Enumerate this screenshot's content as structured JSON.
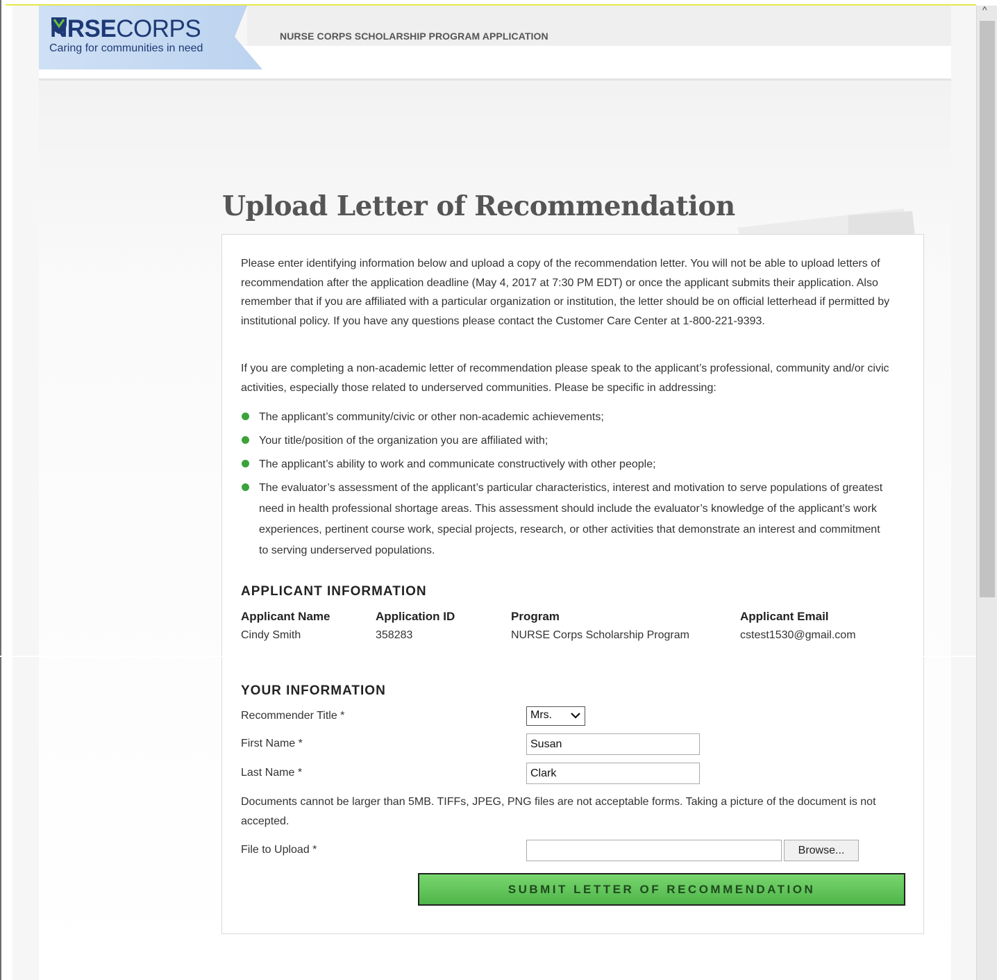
{
  "header": {
    "logo_main_bold_1": "N",
    "logo_main_bold_2": "RSE",
    "logo_main_thin": "CORPS",
    "logo_tagline": "Caring for communities in need",
    "title": "NURSE CORPS SCHOLARSHIP PROGRAM APPLICATION"
  },
  "page": {
    "heading": "Upload Letter of Recommendation",
    "intro_paragraphs": [
      "Please enter identifying information below and upload a copy of the recommendation letter. You will not be able to upload letters of recommendation after the application deadline (May 4, 2017 at 7:30 PM EDT) or once the applicant submits their application. Also remember that if you are affiliated with a particular organization or institution, the letter should be on official letterhead if permitted by institutional policy. If you have any questions please contact the Customer Care Center at 1-800-221-9393.",
      "If you are completing a non-academic letter of recommendation please speak to the applicant’s professional, community and/or civic activities, especially those related to underserved communities. Please be specific in addressing:"
    ],
    "bullets": [
      "The applicant’s community/civic or other non-academic achievements;",
      "Your title/position of the organization you are affiliated with;",
      "The applicant’s ability to work and communicate constructively with other people;",
      "The evaluator’s assessment of the applicant’s particular characteristics, interest and motivation to serve populations of greatest need in health professional shortage areas. This assessment should include the evaluator’s knowledge of the applicant’s work experiences, pertinent course work, special projects, research, or other activities that demonstrate an interest and commitment to serving underserved populations."
    ],
    "bullet_color": "#3aa33a"
  },
  "applicant": {
    "section_title": "APPLICANT INFORMATION",
    "columns": [
      {
        "header": "Applicant Name",
        "value": "Cindy Smith"
      },
      {
        "header": "Application ID",
        "value": "358283"
      },
      {
        "header": "Program",
        "value": "NURSE Corps Scholarship Program"
      },
      {
        "header": "Applicant Email",
        "value": "cstest1530@gmail.com"
      }
    ]
  },
  "your_info": {
    "section_title": "YOUR INFORMATION",
    "title_label": "Recommender Title *",
    "title_value": "Mrs.",
    "first_name_label": "First Name *",
    "first_name_value": "Susan",
    "last_name_label": "Last Name *",
    "last_name_value": "Clark",
    "documents_note": "Documents cannot be larger than 5MB. TIFFs, JPEG, PNG files are not acceptable forms. Taking a picture of the document is not accepted.",
    "file_label": "File to Upload *",
    "file_value": "",
    "browse_label": "Browse...",
    "submit_label": "SUBMIT LETTER OF RECOMMENDATION",
    "submit_color": "#5cc255"
  },
  "scrollbar": {
    "up_arrow": "^"
  }
}
